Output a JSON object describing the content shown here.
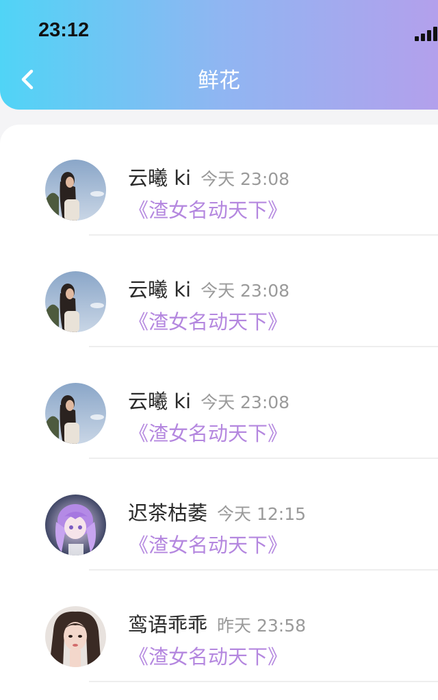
{
  "status_bar": {
    "time": "23:12"
  },
  "header": {
    "title": "鲜花"
  },
  "items": [
    {
      "name": "云曦 ki",
      "time": "今天 23:08",
      "book": "《渣女名动天下》"
    },
    {
      "name": "云曦 ki",
      "time": "今天 23:08",
      "book": "《渣女名动天下》"
    },
    {
      "name": "云曦 ki",
      "time": "今天 23:08",
      "book": "《渣女名动天下》"
    },
    {
      "name": "迟茶枯萎",
      "time": "今天 12:15",
      "book": "《渣女名动天下》"
    },
    {
      "name": "鸾语乖乖",
      "time": "昨天 23:58",
      "book": "《渣女名动天下》"
    }
  ],
  "colors": {
    "header_gradient": [
      "#50d4f6",
      "#b3a0ec"
    ],
    "book_title": "#b487df",
    "timestamp": "#9a9a9a"
  }
}
